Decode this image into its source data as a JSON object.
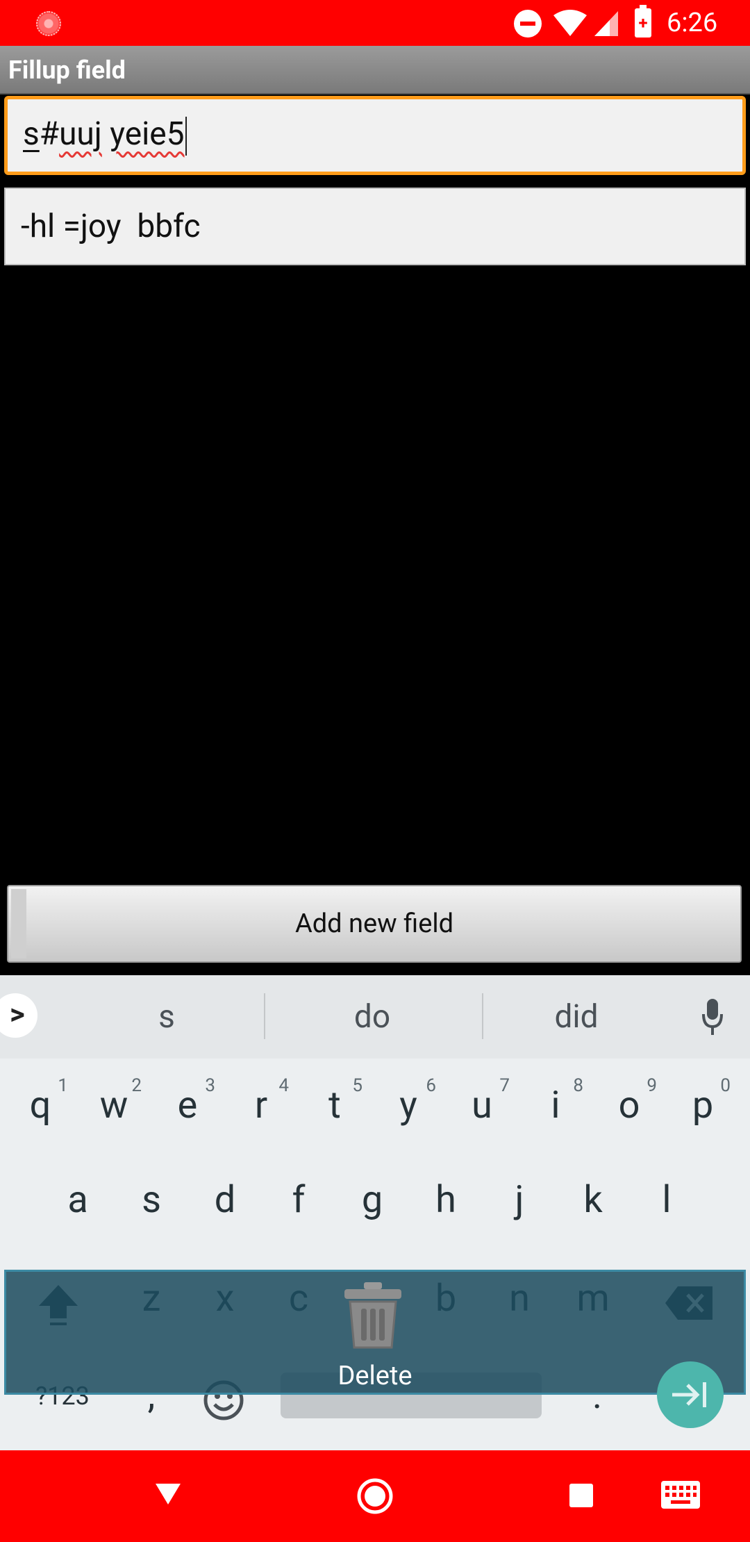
{
  "status_bar": {
    "time": "6:26",
    "icons": [
      "recording-icon",
      "do-not-disturb-icon",
      "wifi-icon",
      "cell-signal-icon",
      "battery-charging-icon"
    ],
    "background": "#ff0000"
  },
  "title_bar": {
    "title": "Fillup field"
  },
  "fields": [
    {
      "value_parts": [
        "s",
        "#",
        "uuj",
        " ",
        "yeie5"
      ],
      "focused": true
    },
    {
      "value": "-hl =joy  bbfc",
      "focused": false
    }
  ],
  "add_button": {
    "label": "Add new field"
  },
  "keyboard": {
    "suggestions": [
      "s",
      "do",
      "did"
    ],
    "row1": [
      {
        "key": "q",
        "hint": "1"
      },
      {
        "key": "w",
        "hint": "2"
      },
      {
        "key": "e",
        "hint": "3"
      },
      {
        "key": "r",
        "hint": "4"
      },
      {
        "key": "t",
        "hint": "5"
      },
      {
        "key": "y",
        "hint": "6"
      },
      {
        "key": "u",
        "hint": "7"
      },
      {
        "key": "i",
        "hint": "8"
      },
      {
        "key": "o",
        "hint": "9"
      },
      {
        "key": "p",
        "hint": "0"
      }
    ],
    "row2": [
      "a",
      "s",
      "d",
      "f",
      "g",
      "h",
      "j",
      "k",
      "l"
    ],
    "row3": [
      "z",
      "x",
      "c",
      "b",
      "n",
      "m"
    ],
    "row4": {
      "symbols": "?123",
      "comma": ",",
      "period": "."
    },
    "delete_overlay": {
      "label": "Delete"
    }
  },
  "nav_bar": {
    "icons": [
      "back-icon",
      "home-icon",
      "recents-icon",
      "keyboard-switch-icon"
    ],
    "background": "#ff0000"
  }
}
